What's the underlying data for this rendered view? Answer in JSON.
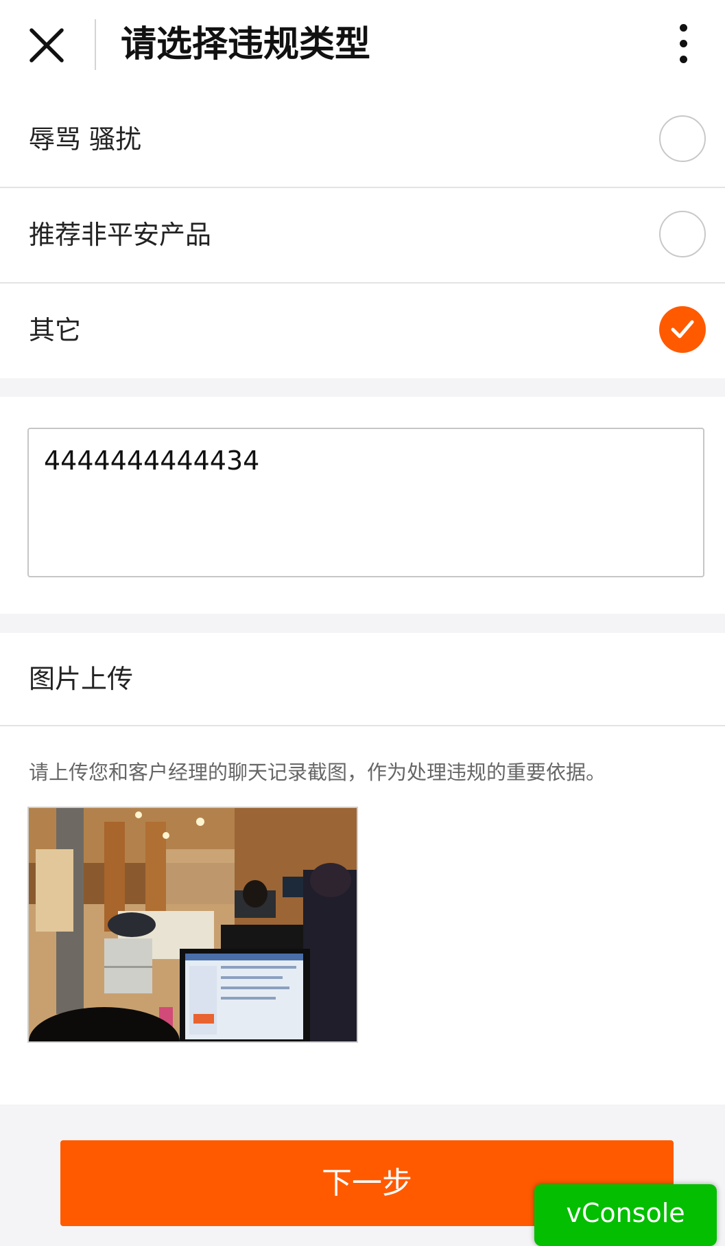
{
  "header": {
    "title": "请选择违规类型",
    "close_icon": "close-icon",
    "more_icon": "more-vertical-icon"
  },
  "options": [
    {
      "label": "辱骂 骚扰",
      "selected": false
    },
    {
      "label": "推荐非平安产品",
      "selected": false
    },
    {
      "label": "其它",
      "selected": true
    }
  ],
  "description": {
    "value": "4444444444434"
  },
  "upload": {
    "title": "图片上传",
    "hint": "请上传您和客户经理的聊天记录截图，作为处理违规的重要依据。"
  },
  "next_button": {
    "label": "下一步"
  },
  "vconsole": {
    "label": "vConsole"
  },
  "colors": {
    "accent": "#ff5a00",
    "vconsole_green": "#04be02",
    "page_bg": "#f4f4f6"
  }
}
